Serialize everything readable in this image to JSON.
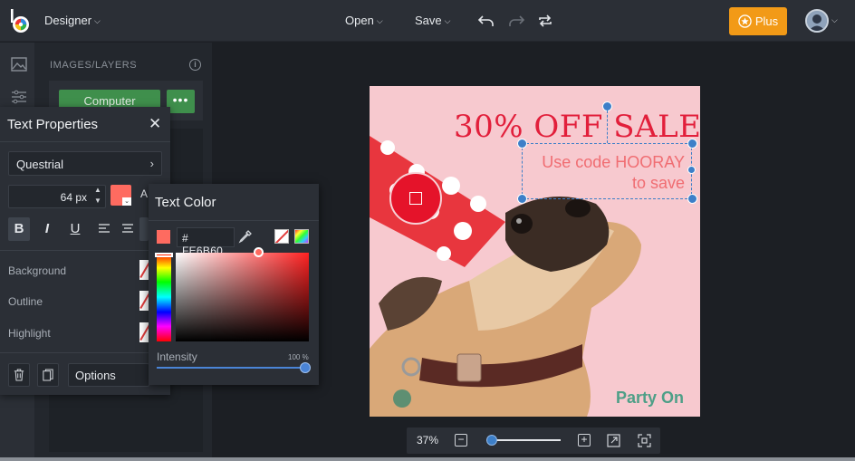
{
  "app": {
    "mode_menu": "Designer",
    "menu": {
      "open": "Open",
      "save": "Save"
    },
    "plus_label": "Plus"
  },
  "panel": {
    "title": "IMAGES/LAYERS",
    "computer_label": "Computer",
    "more_label": "•••"
  },
  "text_properties": {
    "title": "Text Properties",
    "font": "Questrial",
    "size": "64 px",
    "text_color": "#FE6B60",
    "labels": {
      "background": "Background",
      "outline": "Outline",
      "highlight": "Highlight"
    },
    "options_label": "Options",
    "align_peek": "A"
  },
  "text_color": {
    "title": "Text Color",
    "hex": "FE6B60",
    "hash": "#",
    "intensity_label": "Intensity",
    "intensity_value": "100 %",
    "intensity_fraction": 1.0
  },
  "canvas": {
    "headline": "30% OFF SALE!",
    "subline": "Use code HOORAY to save",
    "footer": "Party On"
  },
  "zoom": {
    "value": "37%",
    "fraction": 0.08
  },
  "colors": {
    "accent_orange": "#f29a17",
    "selection_blue": "#3d7fc8",
    "headline_red": "#e21f3b",
    "sub_coral": "#f06d72",
    "party_green": "#4e9f87"
  }
}
